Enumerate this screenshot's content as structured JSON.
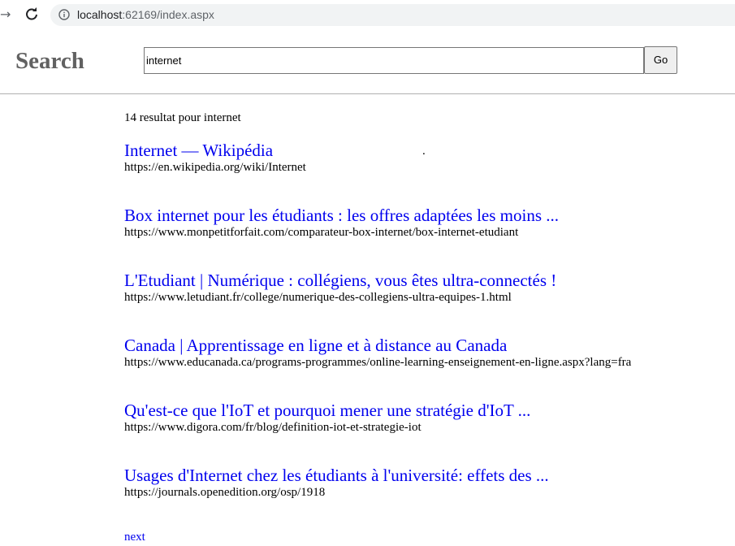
{
  "browser": {
    "url_host": "localhost",
    "url_rest": ":62169/index.aspx",
    "back_icon": "arrow-right-icon",
    "reload_icon": "reload-icon",
    "info_icon": "info-icon"
  },
  "header": {
    "title": "Search",
    "query": "internet",
    "go_label": "Go"
  },
  "results": {
    "count_text": "14 resultat pour internet",
    "stray_text": ".",
    "items": [
      {
        "title": "Internet — Wikipédia",
        "url": "https://en.wikipedia.org/wiki/Internet"
      },
      {
        "title": "Box internet pour les étudiants : les offres adaptées les moins ...",
        "url": "https://www.monpetitforfait.com/comparateur-box-internet/box-internet-etudiant"
      },
      {
        "title": "L'Etudiant | Numérique : collégiens, vous êtes ultra-connectés !",
        "url": "https://www.letudiant.fr/college/numerique-des-collegiens-ultra-equipes-1.html"
      },
      {
        "title": "Canada | Apprentissage en ligne et à distance au Canada",
        "url": "https://www.educanada.ca/programs-programmes/online-learning-enseignement-en-ligne.aspx?lang=fra"
      },
      {
        "title": "Qu'est-ce que l'IoT et pourquoi mener une stratégie d'IoT ...",
        "url": "https://www.digora.com/fr/blog/definition-iot-et-strategie-iot"
      },
      {
        "title": "Usages d'Internet chez les étudiants à l'université: effets des ...",
        "url": "https://journals.openedition.org/osp/1918"
      }
    ],
    "next_label": "next"
  },
  "colors": {
    "link": "#0000ee",
    "title_gray": "#616161",
    "omnibox_bg": "#f1f3f4"
  }
}
